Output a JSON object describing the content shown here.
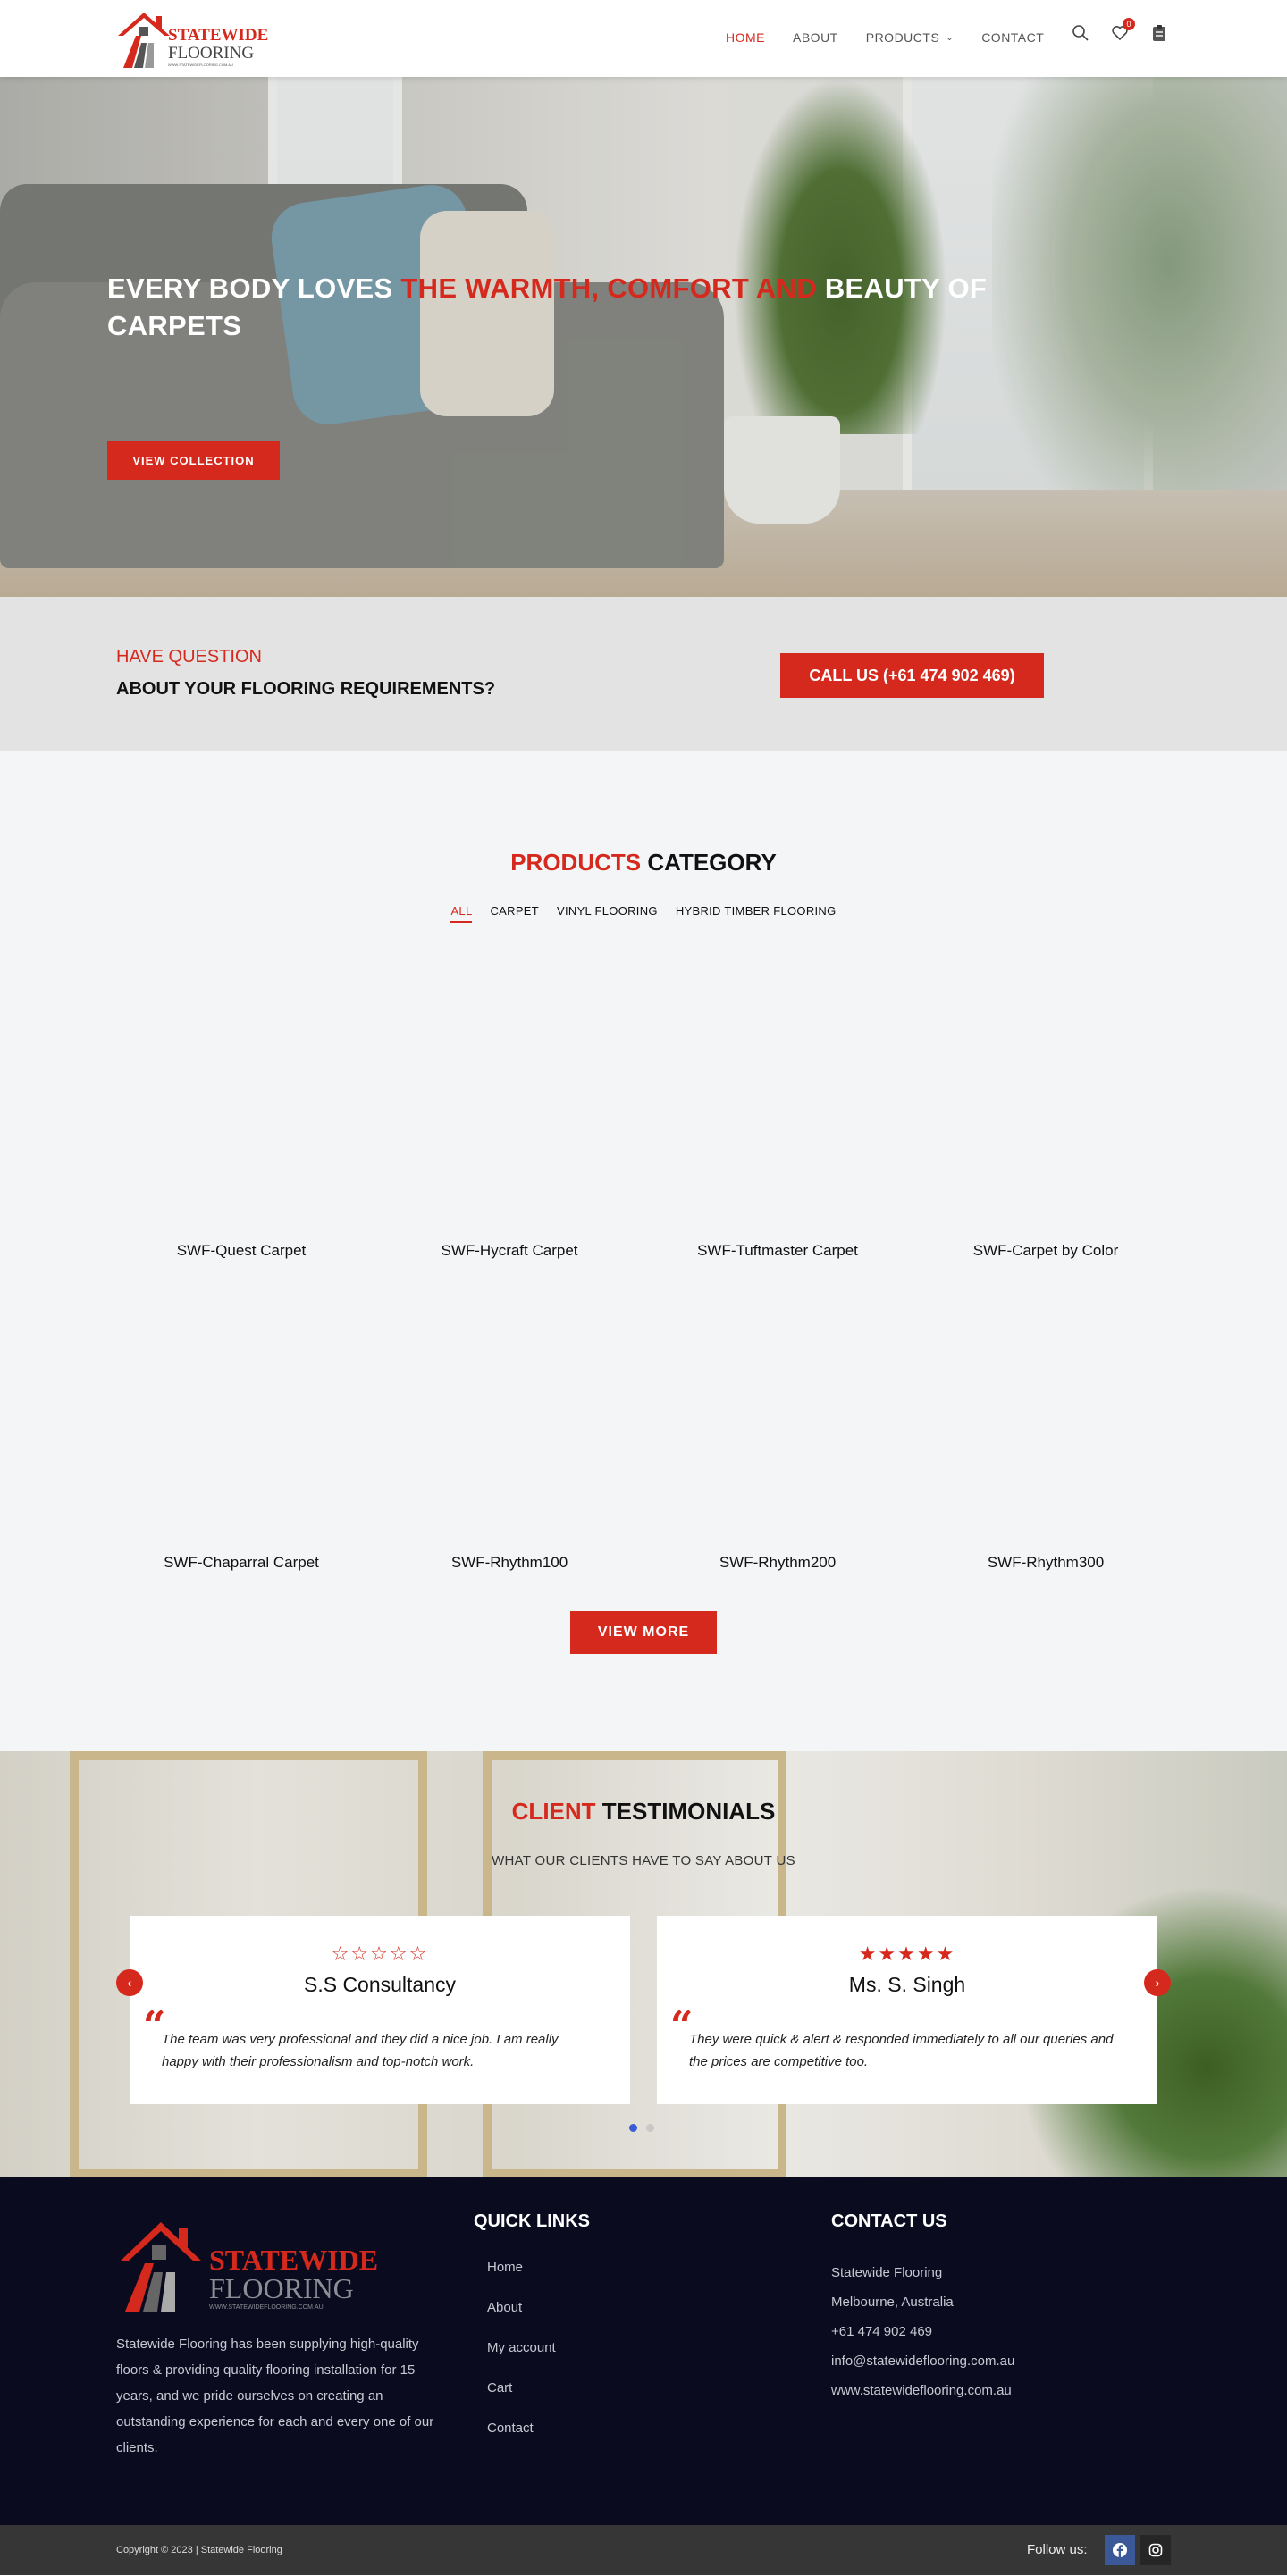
{
  "header": {
    "logo_top": "STATEWIDE",
    "logo_bottom": "FLOORING",
    "logo_tag": "WWW.STATEWIDEFLOORING.COM.AU",
    "nav": [
      {
        "label": "HOME",
        "active": true
      },
      {
        "label": "ABOUT",
        "active": false
      },
      {
        "label": "PRODUCTS",
        "active": false
      },
      {
        "label": "CONTACT",
        "active": false
      }
    ],
    "wishlist_count": "0"
  },
  "hero": {
    "title_part1": "EVERY BODY LOVES ",
    "title_highlight": "THE WARMTH, COMFORT AND",
    "title_part2": " BEAUTY OF CARPETS",
    "button": "VIEW COLLECTION"
  },
  "question": {
    "line1": "HAVE QUESTION",
    "line2": "ABOUT YOUR FLOORING REQUIREMENTS?",
    "button": "CALL US (+61 474 902 469)"
  },
  "products": {
    "title_red": "PRODUCTS",
    "title_rest": " CATEGORY",
    "tabs": [
      "ALL",
      "CARPET",
      "VINYL FLOORING",
      "HYBRID TIMBER FLOORING"
    ],
    "items": [
      "SWF-Quest Carpet",
      "SWF-Hycraft Carpet",
      "SWF-Tuftmaster Carpet",
      "SWF-Carpet by Color",
      "SWF-Chaparral Carpet",
      "SWF-Rhythm100",
      "SWF-Rhythm200",
      "SWF-Rhythm300"
    ],
    "more_button": "VIEW MORE"
  },
  "testimonials": {
    "title_red": "CLIENT",
    "title_rest": " TESTIMONIALS",
    "subtitle": "WHAT OUR CLIENTS HAVE TO SAY ABOUT US",
    "cards": [
      {
        "name": "S.S Consultancy",
        "stars": "☆☆☆☆☆",
        "rating": 0,
        "text": "The team was very professional and they did a nice job. I am really happy with their professionalism and top-notch work."
      },
      {
        "name": "Ms. S. Singh",
        "stars": "★★★★★",
        "rating": 5,
        "text": "They were quick & alert & responded immediately to all our queries and the prices are competitive too."
      }
    ]
  },
  "footer": {
    "logo_top": "STATEWIDE",
    "logo_bottom": "FLOORING",
    "logo_tag": "WWW.STATEWIDEFLOORING.COM.AU",
    "about": "Statewide Flooring has been supplying high-quality floors & providing quality flooring installation for 15 years, and we pride ourselves on creating an outstanding experience for each and every one of our clients.",
    "quick_links_title": "QUICK LINKS",
    "quick_links": [
      "Home",
      "About",
      "My account",
      "Cart",
      "Contact"
    ],
    "contact_title": "CONTACT US",
    "contact": [
      "Statewide Flooring",
      "Melbourne, Australia",
      "+61 474 902 469",
      "info@statewideflooring.com.au",
      "www.statewideflooring.com.au"
    ],
    "copyright": "Copyright © 2023 | Statewide Flooring",
    "follow": "Follow us:"
  },
  "colors": {
    "accent": "#d6291d",
    "footer_bg": "#0a0b1e",
    "copy_bg": "#363636",
    "light_bg": "#f4f5f7"
  }
}
